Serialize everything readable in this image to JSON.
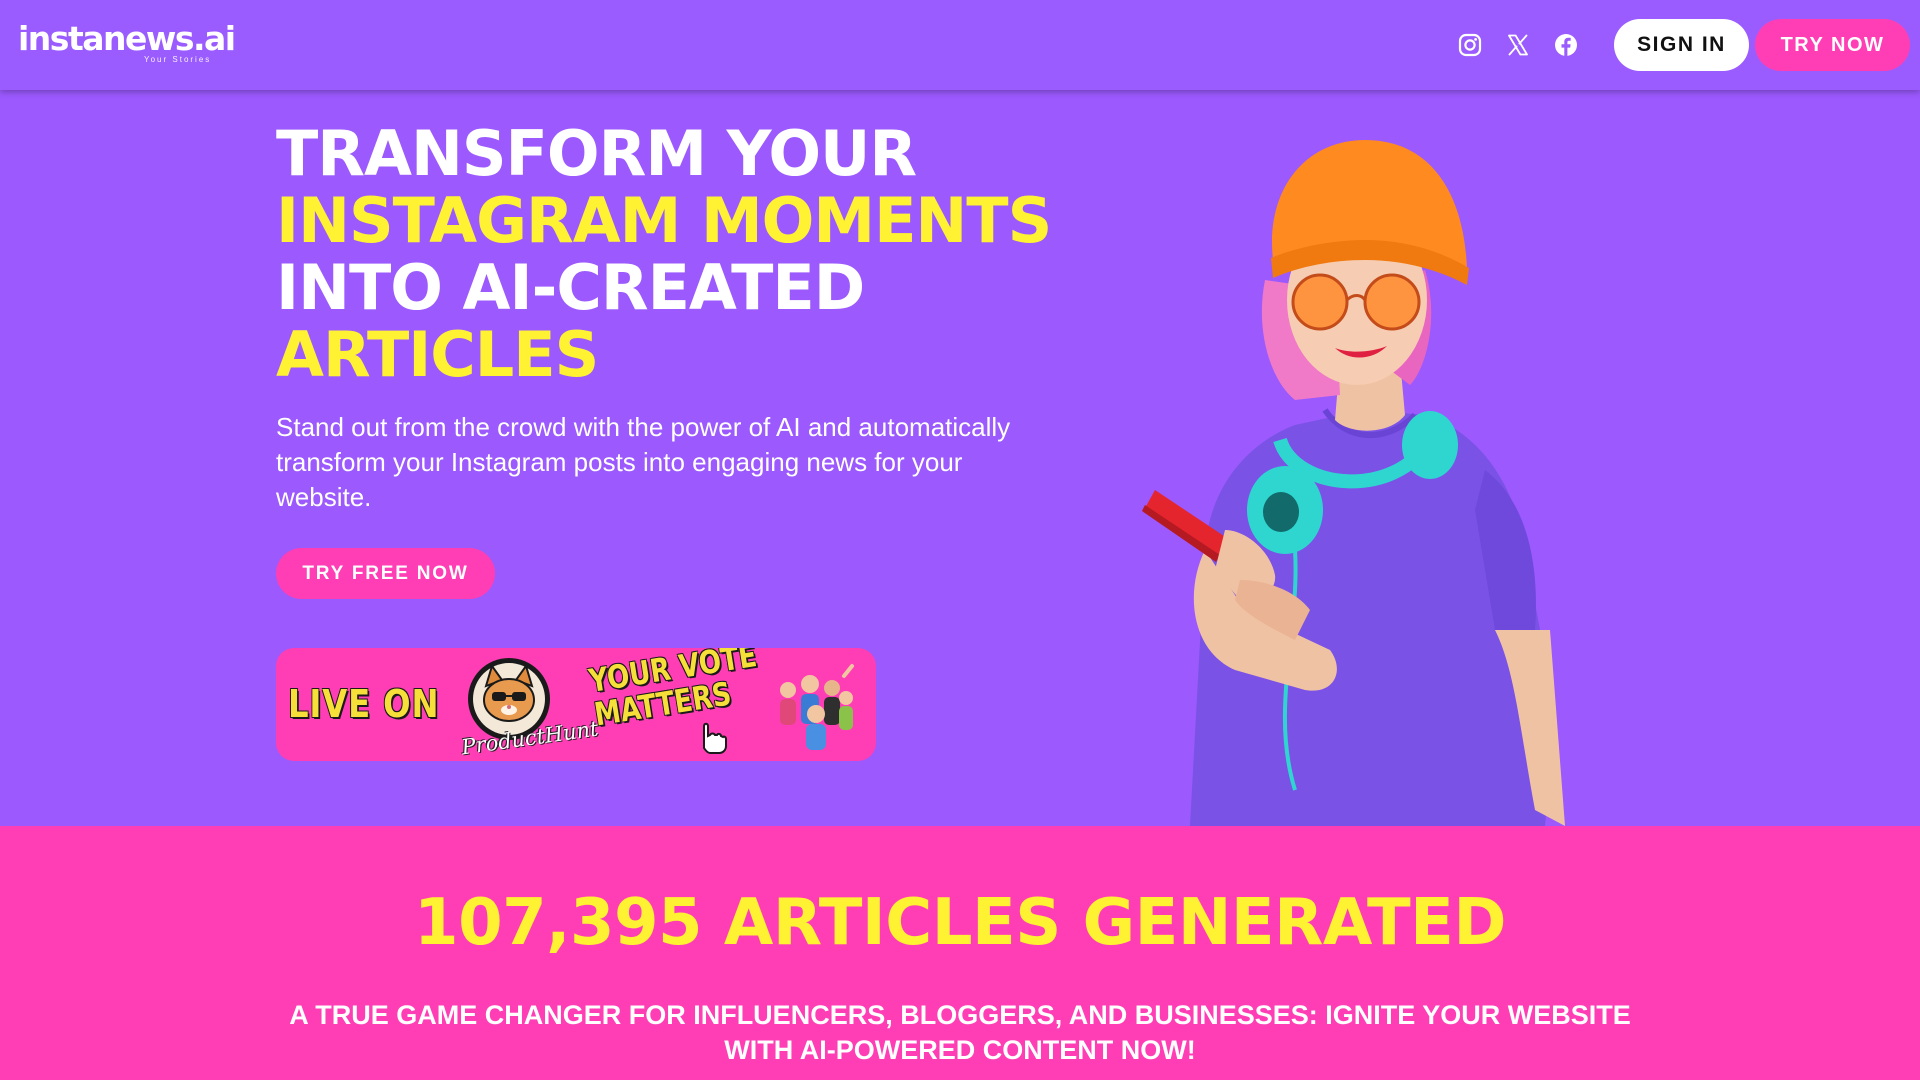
{
  "header": {
    "logo_text": "instanews.ai",
    "logo_tagline": "Your Stories",
    "social": [
      {
        "icon": "instagram-icon"
      },
      {
        "icon": "x-twitter-icon"
      },
      {
        "icon": "facebook-icon"
      }
    ],
    "sign_in_label": "SIGN IN",
    "try_now_label": "TRY NOW"
  },
  "hero": {
    "headline": {
      "line1": "TRANSFORM YOUR",
      "line2": "INSTAGRAM MOMENTS",
      "line3": "INTO AI-CREATED",
      "line4": "ARTICLES"
    },
    "subtitle": "Stand out from the crowd with the power of AI and automatically transform your Instagram posts into engaging news for your website.",
    "cta_label": "TRY FREE NOW",
    "product_hunt_banner": {
      "live_on": "LIVE ON",
      "product_hunt": "ProductHunt",
      "vote_line1": "YOUR VOTE",
      "vote_line2": "MATTERS"
    }
  },
  "stats": {
    "count_text": "107,395 ARTICLES GENERATED",
    "tagline": "A TRUE GAME CHANGER FOR INFLUENCERS, BLOGGERS, AND BUSINESSES: IGNITE YOUR WEBSITE WITH AI-POWERED CONTENT NOW!"
  },
  "colors": {
    "header_bg": "#9b5cff",
    "hero_bg": "#9b59fe",
    "accent_pink": "#ff3eb5",
    "highlight_yellow": "#fff233",
    "white": "#ffffff"
  }
}
